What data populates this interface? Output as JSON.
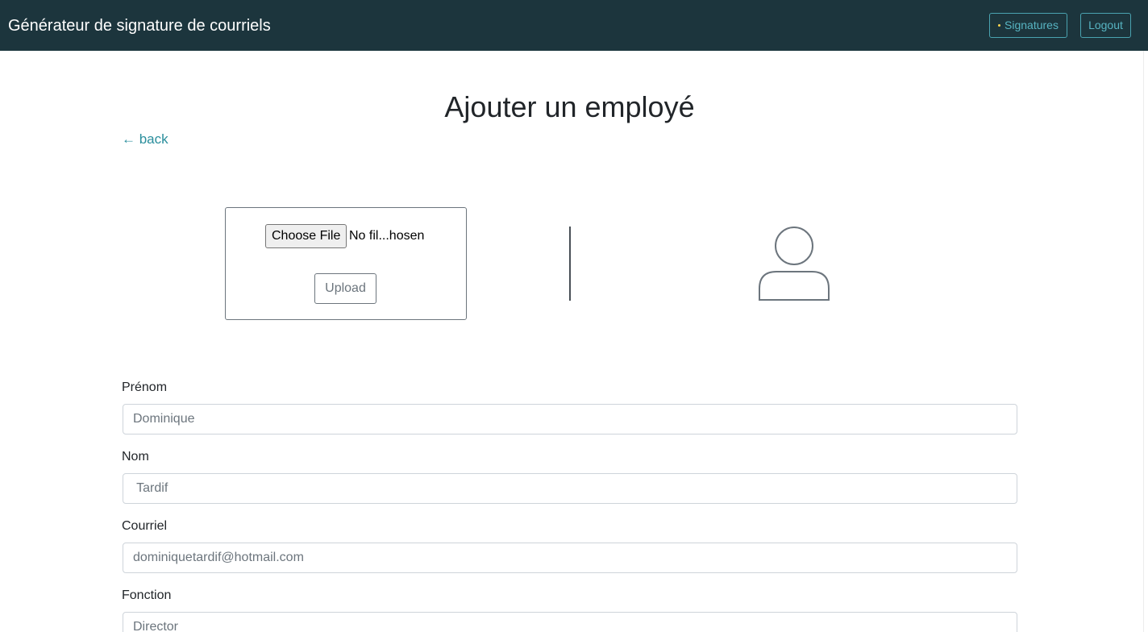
{
  "navbar": {
    "brand": "Générateur de signature de courriels",
    "signatures_label": "Signatures",
    "logout_label": "Logout"
  },
  "page": {
    "title": "Ajouter un employé",
    "back_label": "← back"
  },
  "upload": {
    "choose_file_label": "Choose File",
    "no_file_text": "No fil...hosen",
    "upload_label": "Upload"
  },
  "avatar": {
    "icon": "user-placeholder-icon"
  },
  "form": {
    "prenom": {
      "label": "Prénom",
      "placeholder": "Dominique"
    },
    "nom": {
      "label": "Nom",
      "placeholder": " Tardif"
    },
    "courriel": {
      "label": "Courriel",
      "placeholder": "dominiquetardif@hotmail.com"
    },
    "fonction": {
      "label": "Fonction",
      "placeholder": "Director"
    }
  },
  "colors": {
    "navbar_bg": "#1c353d",
    "accent": "#2a8e9c"
  }
}
